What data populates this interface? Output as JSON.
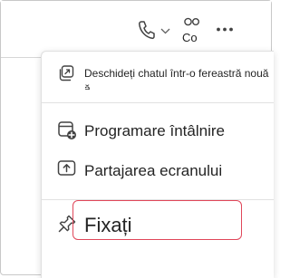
{
  "header": {
    "people_label": "Co",
    "icons": [
      "phone-icon",
      "chevron-down-icon",
      "people-icon",
      "more-options-icon"
    ]
  },
  "menu": {
    "open_window_label": "Deschideți chatul într-o fereastră nouă",
    "open_window_label_overflow": "ă",
    "schedule_label": "Programare întâlnire",
    "share_screen_label": "Partajarea ecranului",
    "pin_label": "Fixați"
  },
  "colors": {
    "highlight": "#e0475a",
    "text": "#242424",
    "divider": "#e1e1e1"
  }
}
